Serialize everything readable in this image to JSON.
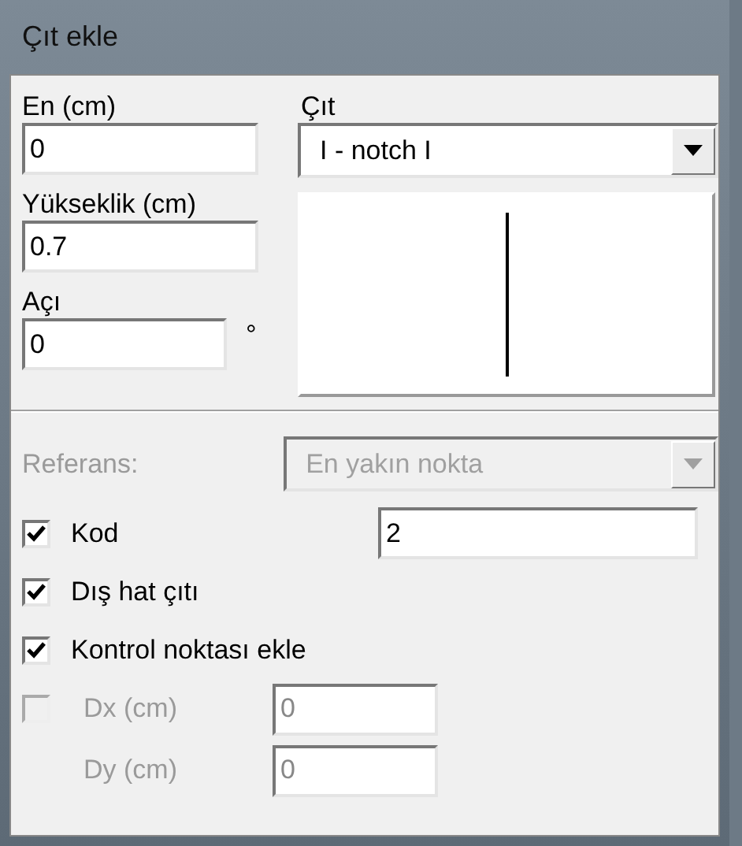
{
  "window": {
    "title": "Çıt ekle"
  },
  "fields": [
    {
      "label": "En (cm)",
      "value": "0"
    },
    {
      "label": "Yükseklik (cm)",
      "value": "0.7"
    },
    {
      "label": "Açı",
      "value": "0",
      "unit": "°"
    }
  ],
  "fence": {
    "label": "Çıt",
    "value": "I - notch I"
  },
  "reference": {
    "label": "Referans:",
    "value": "En yakın nokta",
    "disabled": true
  },
  "options": [
    {
      "kind": "checkbox-field",
      "label": "Kod",
      "checked": true,
      "value": "2"
    },
    {
      "kind": "checkbox",
      "label": "Dış hat çıtı",
      "checked": true
    },
    {
      "kind": "checkbox",
      "label": "Kontrol noktası ekle",
      "checked": true
    }
  ],
  "offset": {
    "checked": false,
    "disabled": true,
    "fields": [
      {
        "label": "Dx (cm)",
        "value": "0"
      },
      {
        "label": "Dy (cm)",
        "value": "0"
      }
    ]
  }
}
